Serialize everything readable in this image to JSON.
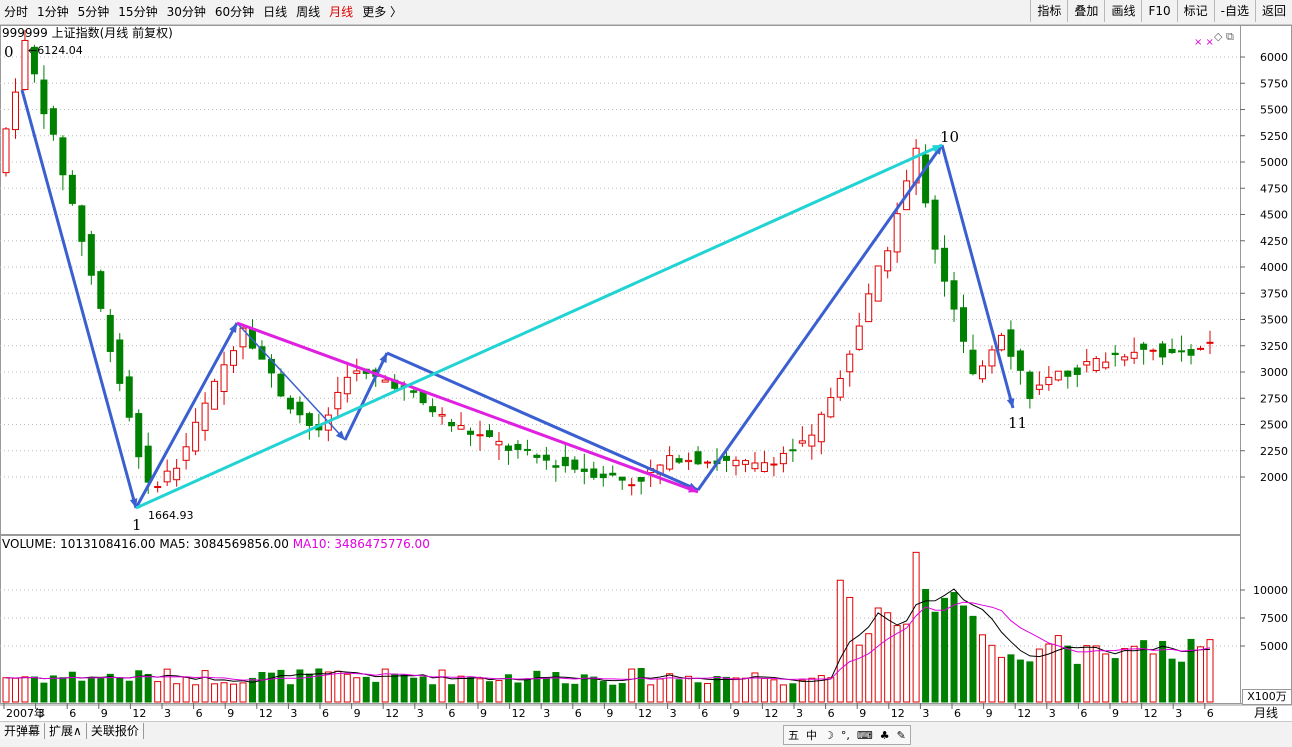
{
  "toolbar": {
    "periods": [
      "分时",
      "1分钟",
      "5分钟",
      "15分钟",
      "30分钟",
      "60分钟",
      "日线",
      "周线",
      "月线",
      "更多 〉"
    ],
    "active_period_index": 8,
    "right_buttons": [
      "指标",
      "叠加",
      "画线",
      "F10",
      "标记",
      "-自选",
      "返回"
    ]
  },
  "chart": {
    "title": "999999 上证指数(月线 前复权)",
    "high_marker": "0",
    "high_value": "6124.04",
    "low_marker": "1",
    "low_value": "1664.93",
    "point_labels": [
      "10",
      "11"
    ],
    "price_ticks": [
      "6000",
      "5750",
      "5500",
      "5250",
      "5000",
      "4750",
      "4500",
      "4250",
      "4000",
      "3750",
      "3500",
      "3250",
      "3000",
      "2750",
      "2500",
      "2250",
      "2000"
    ],
    "up_color": "#e00000",
    "down_color": "#008000"
  },
  "volume": {
    "label": "VOLUME: 1013108416.00",
    "ma5": "MA5: 3084569856.00",
    "ma10": "MA10: 3486475776.00",
    "ticks": [
      "10000",
      "7500",
      "5000"
    ],
    "unit": "X100万"
  },
  "xaxis": {
    "labels": [
      "2007年",
      "3",
      "6",
      "9",
      "12",
      "3",
      "6",
      "9",
      "12",
      "3",
      "6",
      "9",
      "12",
      "3",
      "6",
      "9",
      "12",
      "3",
      "6",
      "9",
      "12",
      "3",
      "6",
      "9",
      "12",
      "3",
      "6",
      "9",
      "12",
      "3",
      "6",
      "9",
      "12",
      "3",
      "6",
      "9",
      "12",
      "3",
      "6"
    ],
    "period_label": "月线"
  },
  "bottom": {
    "tabs": [
      "开弹幕",
      "扩展∧",
      "关联报价"
    ],
    "ime": [
      "五",
      "中",
      "☽",
      "°,",
      "⌨",
      "♣",
      "✎"
    ]
  }
}
